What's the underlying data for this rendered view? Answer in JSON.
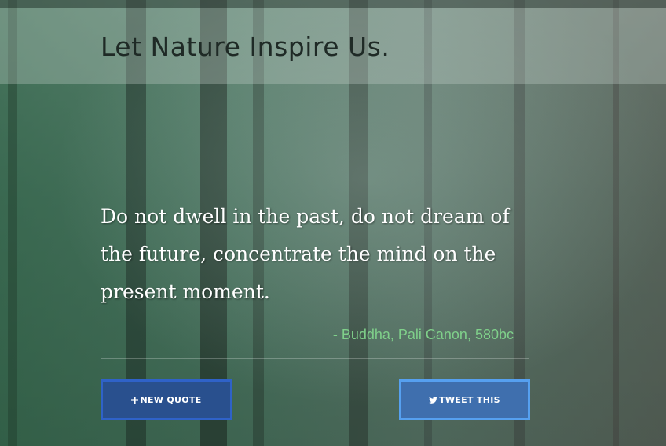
{
  "header": {
    "title": "Let Nature Inspire Us."
  },
  "quote": {
    "text": "Do not dwell in the past, do not dream of the future, concentrate the mind on the present moment.",
    "author": "- Buddha, Pali Canon, 580bc"
  },
  "actions": {
    "new_quote_label": "NEW QUOTE",
    "new_quote_icon": "plus-icon",
    "tweet_label": "TWEET THIS",
    "tweet_icon": "twitter-icon"
  },
  "colors": {
    "author": "#7fd08a",
    "new_quote_button": "#29508e",
    "tweet_button": "#3f6fae"
  }
}
